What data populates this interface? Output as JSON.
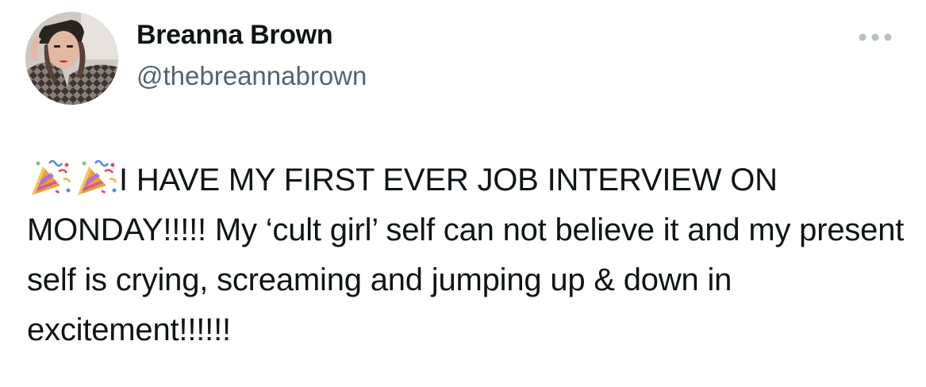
{
  "author": {
    "display_name": "Breanna Brown",
    "handle": "@thebreannabrown",
    "avatar_icon": "profile-photo"
  },
  "more_button": {
    "icon": "more-horizontal-icon"
  },
  "tweet": {
    "emoji": [
      "party-popper-icon",
      "party-popper-icon"
    ],
    "text": "I HAVE MY FIRST EVER JOB INTERVIEW ON MONDAY!!!!! My ‘cult girl’ self can not believe it and my present self is crying, screaming and jumping up & down in excitement!!!!!!"
  },
  "colors": {
    "text": "#0f1419",
    "secondary_text": "#536471",
    "more_dots": "#b7c0c8"
  }
}
